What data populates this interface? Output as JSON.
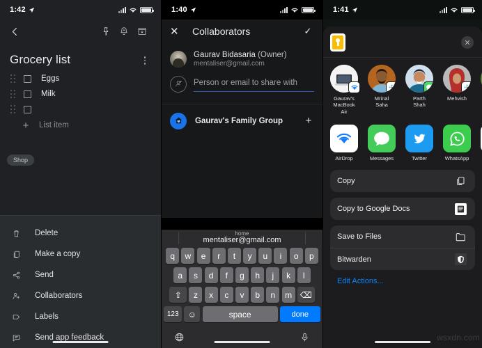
{
  "panel1": {
    "status": {
      "time": "1:42"
    },
    "toolbar": {
      "back": "back-arrow",
      "pin": "pin-icon",
      "reminder": "reminder-bell-icon",
      "archive": "archive-icon"
    },
    "note": {
      "title": "Grocery list",
      "overflow_label": "More options",
      "items": [
        {
          "text": "Eggs",
          "checked": false
        },
        {
          "text": "Milk",
          "checked": false
        },
        {
          "text": "",
          "checked": false
        }
      ],
      "add_item_label": "List item",
      "label_chip": "Shop"
    },
    "menu": [
      {
        "label": "Delete",
        "icon": "trash-icon"
      },
      {
        "label": "Make a copy",
        "icon": "copy-icon"
      },
      {
        "label": "Send",
        "icon": "share-icon"
      },
      {
        "label": "Collaborators",
        "icon": "person-add-icon"
      },
      {
        "label": "Labels",
        "icon": "label-icon"
      },
      {
        "label": "Send app feedback",
        "icon": "feedback-icon"
      }
    ]
  },
  "panel2": {
    "status": {
      "time": "1:40"
    },
    "header": {
      "close": "✕",
      "title": "Collaborators",
      "confirm": "✓"
    },
    "owner": {
      "name": "Gaurav Bidasaria",
      "role": "(Owner)",
      "email": "mentaliser@gmail.com"
    },
    "share_input": {
      "value": "",
      "placeholder": "Person or email to share with"
    },
    "group": {
      "name": "Gaurav's Family Group",
      "add": "+"
    },
    "keyboard": {
      "suggestion_label": "home",
      "suggestion_value": "mentaliser@gmail.com",
      "row1": [
        "q",
        "w",
        "e",
        "r",
        "t",
        "y",
        "u",
        "i",
        "o",
        "p"
      ],
      "row2": [
        "a",
        "s",
        "d",
        "f",
        "g",
        "h",
        "j",
        "k",
        "l"
      ],
      "row3": [
        "z",
        "x",
        "c",
        "v",
        "b",
        "n",
        "m"
      ],
      "shift": "⇧",
      "backspace": "⌫",
      "numbers": "123",
      "emoji": "☺",
      "space": "space",
      "done": "done",
      "globe": "globe-icon",
      "mic": "microphone-icon"
    }
  },
  "panel3": {
    "status": {
      "time": "1:41"
    },
    "sheet": {
      "doc_icon": "google-keep-doc-icon",
      "close": "✕"
    },
    "people": [
      {
        "name": "Gaurav's\nMacBook Air",
        "line1": "Gaurav's",
        "line2": "MacBook Air",
        "badge": "airdrop-badge"
      },
      {
        "name": "Mrinal Saha",
        "line1": "Mrinal",
        "line2": "Saha",
        "badge": "slack-badge"
      },
      {
        "name": "Parth Shah",
        "line1": "Parth",
        "line2": "Shah",
        "badge": "messages-badge"
      },
      {
        "name": "Mehvish",
        "line1": "Mehvish",
        "line2": "",
        "badge": "slack-badge"
      }
    ],
    "apps": [
      {
        "name": "AirDrop",
        "icon": "airdrop-icon",
        "color": "#ffffff"
      },
      {
        "name": "Messages",
        "icon": "messages-icon",
        "color": "#4cd964"
      },
      {
        "name": "Twitter",
        "icon": "twitter-icon",
        "color": "#1d9bf0"
      },
      {
        "name": "WhatsApp",
        "icon": "whatsapp-icon",
        "color": "#3ccc4e"
      }
    ],
    "actions_group1": [
      {
        "label": "Copy",
        "icon": "copy-icon"
      }
    ],
    "actions_group2": [
      {
        "label": "Copy to Google Docs",
        "icon": "google-docs-icon"
      }
    ],
    "actions_group3": [
      {
        "label": "Save to Files",
        "icon": "folder-icon"
      },
      {
        "label": "Bitwarden",
        "icon": "bitwarden-shield-icon"
      }
    ],
    "edit_actions": "Edit Actions..."
  },
  "watermark": "wsxdn.com"
}
